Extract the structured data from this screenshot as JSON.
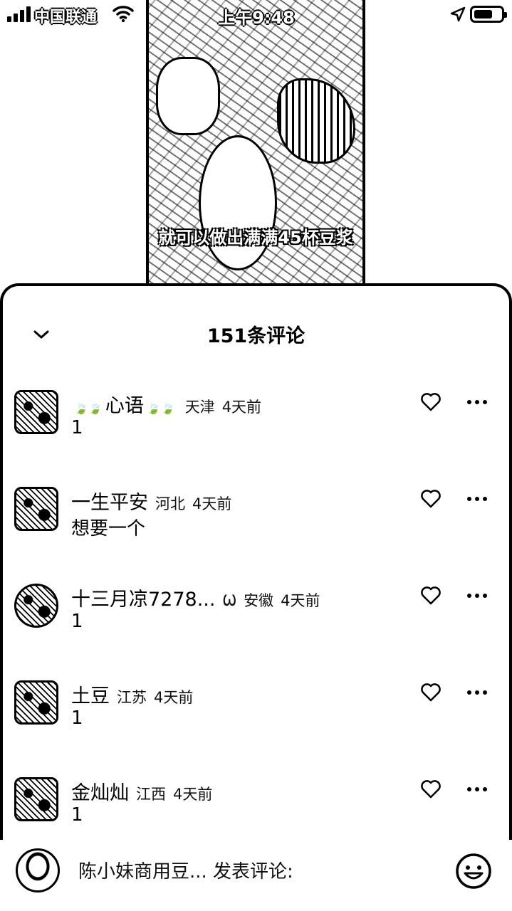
{
  "status_bar": {
    "carrier": "中国联通",
    "time": "上午9:48"
  },
  "video": {
    "subtitle": "就可以做出满满45杯豆浆"
  },
  "comments_sheet": {
    "title": "151条评论",
    "comments": [
      {
        "name": "心语",
        "deco": "🍃🍃",
        "deco_after": "🍃🍃",
        "location": "天津",
        "time": "4天前",
        "text": "1"
      },
      {
        "name": "一生平安",
        "location": "河北",
        "time": "4天前",
        "text": "想要一个"
      },
      {
        "name": "十三月凉7278...",
        "badge": "Ѡ",
        "location": "安徽",
        "time": "4天前",
        "text": "1"
      },
      {
        "name": "土豆",
        "location": "江苏",
        "time": "4天前",
        "text": "1"
      },
      {
        "name": "金灿灿",
        "location": "江西",
        "time": "4天前",
        "text": "1"
      }
    ]
  },
  "input_bar": {
    "placeholder": "陈小妹商用豆... 发表评论:"
  }
}
